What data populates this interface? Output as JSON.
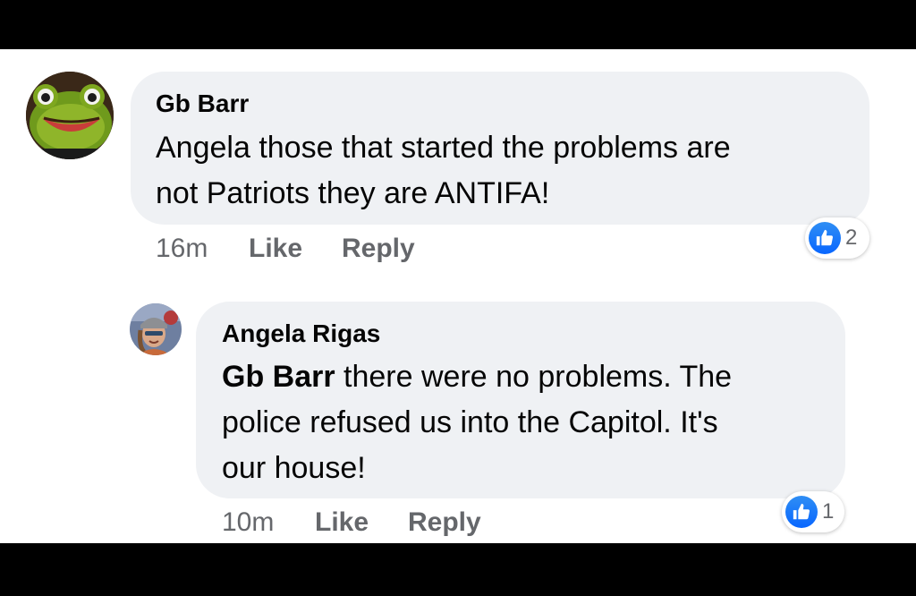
{
  "comments": [
    {
      "author": "Gb Barr",
      "text_lines": [
        "Angela those that started the problems are",
        "not Patriots they are ANTIFA!"
      ],
      "time": "16m",
      "like_label": "Like",
      "reply_label": "Reply",
      "reaction_count": "2",
      "reaction_icon": "thumbs-up-icon",
      "avatar": "frog-avatar"
    },
    {
      "author": "Angela Rigas",
      "mention": "Gb Barr",
      "text_line1_rest": " there were no problems. The",
      "text_lines": [
        "police refused us into the Capitol. It's",
        "our house!"
      ],
      "time": "10m",
      "like_label": "Like",
      "reply_label": "Reply",
      "reaction_count": "1",
      "reaction_icon": "thumbs-up-icon",
      "avatar": "person-avatar"
    }
  ],
  "colors": {
    "bubble": "#eff1f4",
    "meta": "#65676b",
    "like_blue": "#0866ff",
    "frame": "#000000"
  }
}
